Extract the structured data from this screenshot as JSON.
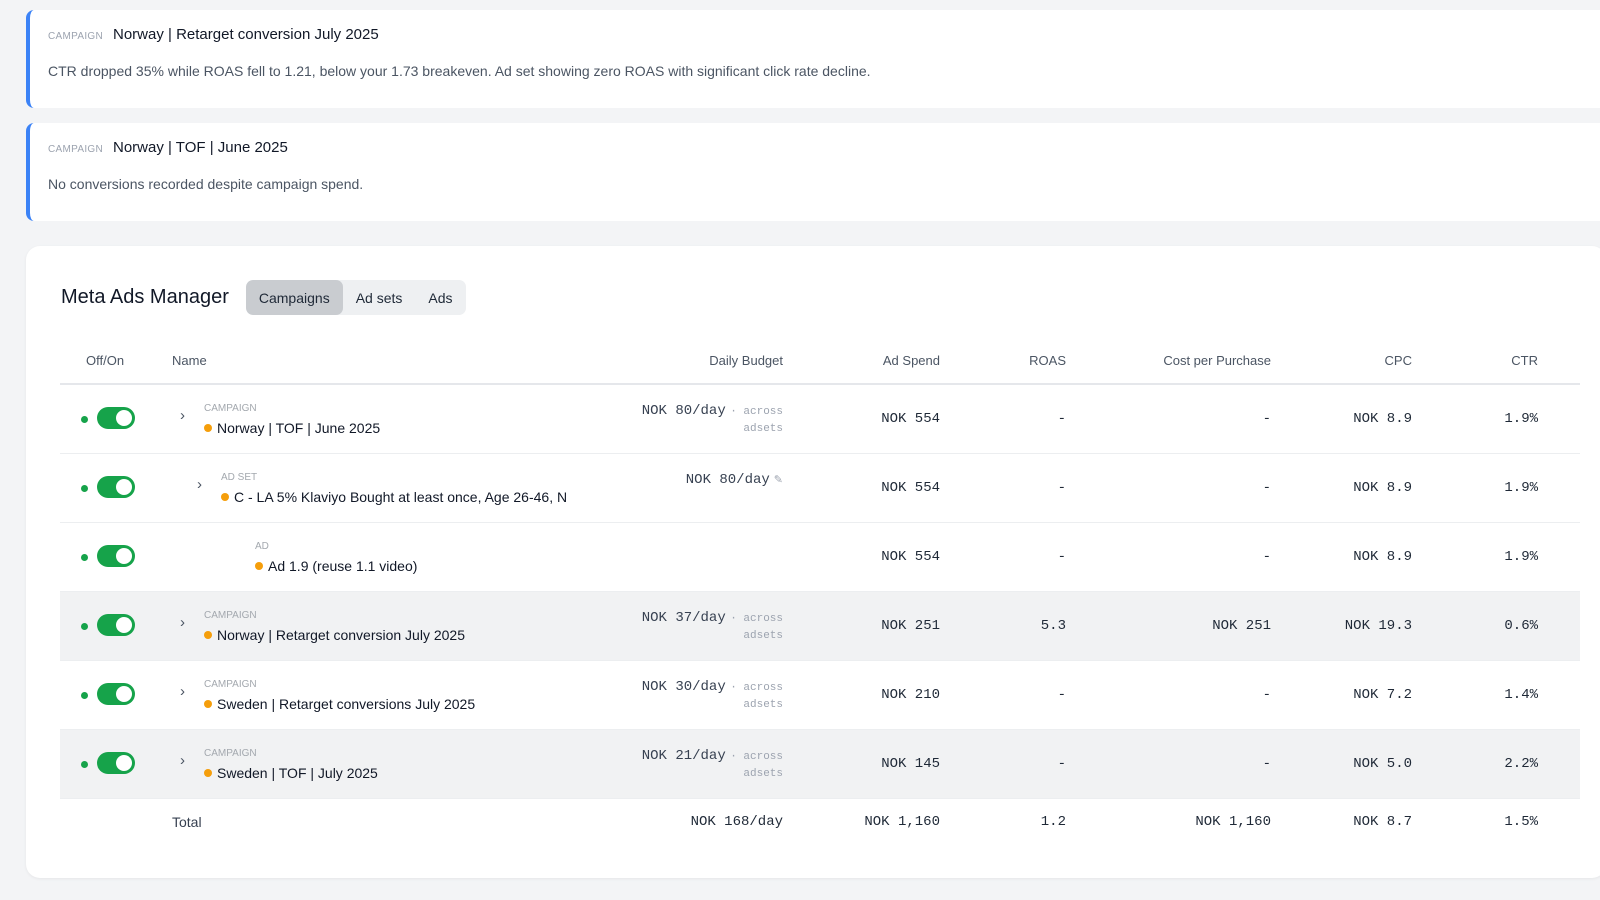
{
  "alerts": [
    {
      "tag": "CAMPAIGN",
      "title": "Norway | Retarget conversion July 2025",
      "message": "CTR dropped 35% while ROAS fell to 1.21, below your 1.73 breakeven. Ad set showing zero ROAS with significant click rate decline."
    },
    {
      "tag": "CAMPAIGN",
      "title": "Norway | TOF | June 2025",
      "message": "No conversions recorded despite campaign spend."
    }
  ],
  "panel": {
    "title": "Meta Ads Manager",
    "tabs": [
      {
        "label": "Campaigns",
        "active": true
      },
      {
        "label": "Ad sets",
        "active": false
      },
      {
        "label": "Ads",
        "active": false
      }
    ]
  },
  "table": {
    "headers": {
      "offon": "Off/On",
      "name": "Name",
      "budget": "Daily Budget",
      "spend": "Ad Spend",
      "roas": "ROAS",
      "cpp": "Cost per Purchase",
      "cpc": "CPC",
      "ctr": "CTR"
    },
    "rows": [
      {
        "level": "CAMPAIGN",
        "name": "Norway | TOF | June 2025",
        "budget": "NOK 80/day",
        "budget_suffix": "· across",
        "budget_line2": "adsets",
        "spend": "NOK 554",
        "roas": "-",
        "cpp": "-",
        "cpc": "NOK 8.9",
        "ctr": "1.9%"
      },
      {
        "level": "AD SET",
        "name": "C - LA 5% Klaviyo Bought at least once, Age 26-46, N",
        "budget": "NOK 80/day",
        "budget_suffix": "",
        "budget_line2": "",
        "spend": "NOK 554",
        "roas": "-",
        "cpp": "-",
        "cpc": "NOK 8.9",
        "ctr": "1.9%"
      },
      {
        "level": "AD",
        "name": "Ad 1.9 (reuse 1.1 video)",
        "budget": "",
        "budget_suffix": "",
        "budget_line2": "",
        "spend": "NOK 554",
        "roas": "-",
        "cpp": "-",
        "cpc": "NOK 8.9",
        "ctr": "1.9%"
      },
      {
        "level": "CAMPAIGN",
        "name": "Norway | Retarget conversion July 2025",
        "budget": "NOK 37/day",
        "budget_suffix": "· across",
        "budget_line2": "adsets",
        "spend": "NOK 251",
        "roas": "5.3",
        "cpp": "NOK 251",
        "cpc": "NOK 19.3",
        "ctr": "0.6%"
      },
      {
        "level": "CAMPAIGN",
        "name": "Sweden | Retarget conversions July 2025",
        "budget": "NOK 30/day",
        "budget_suffix": "· across",
        "budget_line2": "adsets",
        "spend": "NOK 210",
        "roas": "-",
        "cpp": "-",
        "cpc": "NOK 7.2",
        "ctr": "1.4%"
      },
      {
        "level": "CAMPAIGN",
        "name": "Sweden | TOF | July 2025",
        "budget": "NOK 21/day",
        "budget_suffix": "· across",
        "budget_line2": "adsets",
        "spend": "NOK 145",
        "roas": "-",
        "cpp": "-",
        "cpc": "NOK 5.0",
        "ctr": "2.2%"
      }
    ],
    "total": {
      "label": "Total",
      "budget": "NOK 168/day",
      "spend": "NOK 1,160",
      "roas": "1.2",
      "cpp": "NOK 1,160",
      "cpc": "NOK 8.7",
      "ctr": "1.5%"
    }
  },
  "colors": {
    "accent": "#3b82f6",
    "toggle_on": "#16a34a",
    "status_dot": "#f59e0b"
  },
  "icons": {
    "expand": "chevron-right-icon",
    "edit": "pencil-icon"
  }
}
